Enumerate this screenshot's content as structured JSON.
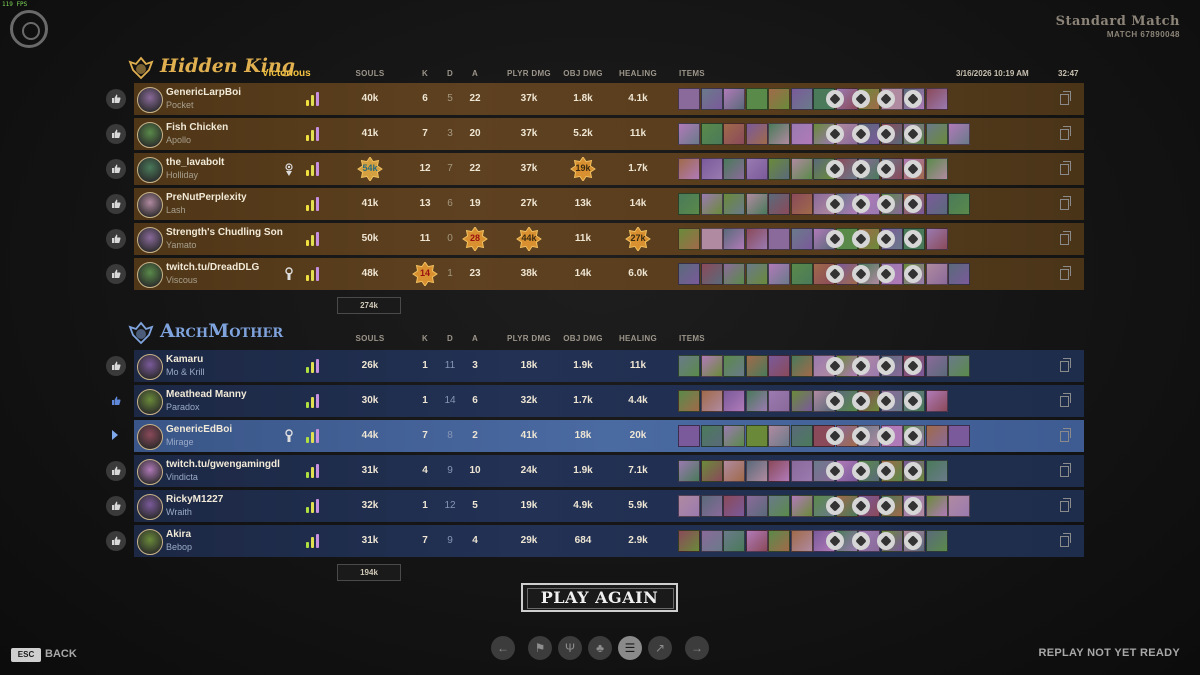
{
  "fps": "119 FPS",
  "match": {
    "title": "Standard Match",
    "id": "MATCH 67890048",
    "date": "3/16/2026 10:19 AM",
    "duration": "32:47"
  },
  "columns": {
    "souls": "SOULS",
    "k": "K",
    "d": "D",
    "a": "A",
    "plyr_dmg": "PLYR DMG",
    "obj_dmg": "OBJ DMG",
    "healing": "HEALING",
    "items": "ITEMS"
  },
  "teams": [
    {
      "name": "Hidden King",
      "result": "Victorious",
      "color": "#e0b050",
      "total_souls": "274k",
      "players": [
        {
          "name": "GenericLarpBoi",
          "hero": "Pocket",
          "souls": "40k",
          "k": "6",
          "d": "5",
          "a": "22",
          "plyr_dmg": "37k",
          "obj_dmg": "1.8k",
          "healing": "4.1k",
          "highlight": {}
        },
        {
          "name": "Fish Chicken",
          "hero": "Apollo",
          "souls": "41k",
          "k": "7",
          "d": "3",
          "a": "20",
          "plyr_dmg": "37k",
          "obj_dmg": "5.2k",
          "healing": "11k",
          "highlight": {}
        },
        {
          "name": "the_lavabolt",
          "hero": "Holliday",
          "souls": "54k",
          "k": "12",
          "d": "7",
          "a": "22",
          "plyr_dmg": "37k",
          "obj_dmg": "19k",
          "healing": "1.7k",
          "special": "eye-icon",
          "highlight": {
            "souls": true,
            "obj_dmg": true
          }
        },
        {
          "name": "PreNutPerplexity",
          "hero": "Lash",
          "souls": "41k",
          "k": "13",
          "d": "6",
          "a": "19",
          "plyr_dmg": "27k",
          "obj_dmg": "13k",
          "healing": "14k",
          "highlight": {}
        },
        {
          "name": "Strength's Chudling Son",
          "hero": "Yamato",
          "souls": "50k",
          "k": "11",
          "d": "0",
          "a": "28",
          "plyr_dmg": "44k",
          "obj_dmg": "11k",
          "healing": "27k",
          "highlight": {
            "a": true,
            "plyr_dmg": true,
            "healing": true
          }
        },
        {
          "name": "twitch.tu/DreadDLG",
          "hero": "Viscous",
          "souls": "48k",
          "k": "14",
          "d": "1",
          "a": "23",
          "plyr_dmg": "38k",
          "obj_dmg": "14k",
          "healing": "6.0k",
          "special": "keyhole-icon",
          "highlight": {
            "k": true
          }
        }
      ]
    },
    {
      "name": "ArchMother",
      "result": "",
      "color": "#7fa3dd",
      "total_souls": "194k",
      "players": [
        {
          "name": "Kamaru",
          "hero": "Mo & Krill",
          "souls": "26k",
          "k": "1",
          "d": "11",
          "a": "3",
          "plyr_dmg": "18k",
          "obj_dmg": "1.9k",
          "healing": "11k",
          "highlight": {}
        },
        {
          "name": "Meathead Manny",
          "hero": "Paradox",
          "souls": "30k",
          "k": "1",
          "d": "14",
          "a": "6",
          "plyr_dmg": "32k",
          "obj_dmg": "1.7k",
          "healing": "4.4k",
          "liked": true,
          "highlight": {}
        },
        {
          "name": "GenericEdBoi",
          "hero": "Mirage",
          "souls": "44k",
          "k": "7",
          "d": "8",
          "a": "2",
          "plyr_dmg": "41k",
          "obj_dmg": "18k",
          "healing": "20k",
          "me": true,
          "special": "keyhole-icon",
          "highlight": {}
        },
        {
          "name": "twitch.tu/gwengamingdl",
          "hero": "Vindicta",
          "souls": "31k",
          "k": "4",
          "d": "9",
          "a": "10",
          "plyr_dmg": "24k",
          "obj_dmg": "1.9k",
          "healing": "7.1k",
          "highlight": {}
        },
        {
          "name": "RickyM1227",
          "hero": "Wraith",
          "souls": "32k",
          "k": "1",
          "d": "12",
          "a": "5",
          "plyr_dmg": "19k",
          "obj_dmg": "4.9k",
          "healing": "5.9k",
          "highlight": {}
        },
        {
          "name": "Akira",
          "hero": "Bebop",
          "souls": "31k",
          "k": "7",
          "d": "9",
          "a": "4",
          "plyr_dmg": "29k",
          "obj_dmg": "684",
          "healing": "2.9k",
          "highlight": {}
        }
      ]
    }
  ],
  "play_again": "PLAY AGAIN",
  "esc_key": "ESC",
  "back_label": "BACK",
  "replay_status": "REPLAY NOT YET READY",
  "nav_icons": [
    "left-arrow-icon",
    "trophy-icon",
    "trident-icon",
    "tree-icon",
    "list-icon",
    "graph-icon",
    "right-arrow-icon"
  ],
  "nav_active_index": 4
}
